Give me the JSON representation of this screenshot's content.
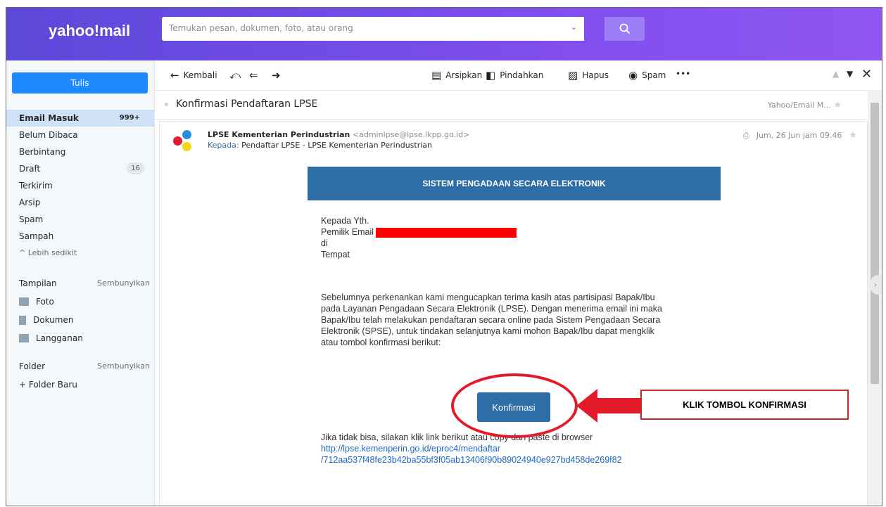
{
  "header": {
    "logo": "yahoo!mail",
    "search_placeholder": "Temukan pesan, dokumen, foto, atau orang"
  },
  "sidebar": {
    "compose_label": "Tulis",
    "items": [
      {
        "label": "Email Masuk",
        "count": "999+"
      },
      {
        "label": "Belum Dibaca"
      },
      {
        "label": "Berbintang"
      },
      {
        "label": "Draft",
        "count": "16"
      },
      {
        "label": "Terkirim"
      },
      {
        "label": "Arsip"
      },
      {
        "label": "Spam"
      },
      {
        "label": "Sampah"
      }
    ],
    "less_label": "^ Lebih sedikit",
    "views": {
      "title": "Tampilan",
      "hide_label": "Sembunyikan",
      "items": [
        "Foto",
        "Dokumen",
        "Langganan"
      ]
    },
    "folders": {
      "title": "Folder",
      "hide_label": "Sembunyikan",
      "new_folder": "+ Folder Baru"
    }
  },
  "toolbar": {
    "back": "Kembali",
    "archive": "Arsipkan",
    "move": "Pindahkan",
    "delete": "Hapus",
    "spam": "Spam",
    "more": "•••"
  },
  "message": {
    "subject": "Konfirmasi Pendaftaran LPSE",
    "folder": "Yahoo/Email M...",
    "sender_name": "LPSE Kementerian Perindustrian",
    "sender_email": "<adminlpse@lpse.lkpp.go.id>",
    "to_label": "Kepada:",
    "to_value": "Pendaftar LPSE - LPSE Kementerian Perindustrian",
    "date": "Jum, 26 Jun jam 09.46",
    "banner": "SISTEM PENGADAAN SECARA ELEKTRONIK",
    "greeting": [
      "Kepada Yth.",
      "Pemilik Email",
      "di",
      "Tempat"
    ],
    "paragraph": [
      "Sebelumnya perkenankan kami mengucapkan terima kasih atas partisipasi Bapak/Ibu",
      "pada Layanan Pengadaan Secara Elektronik (LPSE). Dengan menerima email ini maka",
      "Bapak/Ibu telah melakukan pendaftaran secara online pada Sistem Pengadaan Secara",
      "Elektronik (SPSE), untuk tindakan selanjutnya kami mohon Bapak/Ibu dapat mengklik",
      "atau tombol konfirmasi berikut:"
    ],
    "confirm_button": "Konfirmasi",
    "fallback_text": "Jika tidak bisa, silakan klik link berikut atau copy dan paste di browser",
    "link_line1": "http://lpse.kemenperin.go.id/eproc4/mendaftar",
    "link_line2": "/712aa537f48fe23b42ba55bf3f05ab13406f90b89024940e927bd458de269f82"
  },
  "annotation": {
    "callout": "KLIK TOMBOL KONFIRMASI",
    "color": "#e21a2a"
  }
}
